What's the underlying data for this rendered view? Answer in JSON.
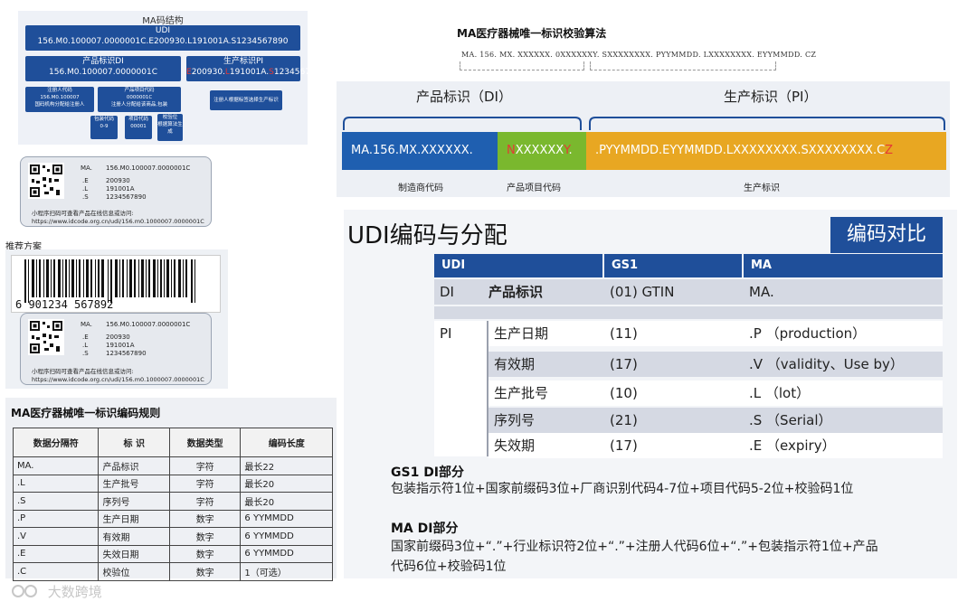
{
  "ma_structure": {
    "title": "MA码结构",
    "udi_label": "UDI",
    "udi_value": "156.M0.100007.0000001C.E200930.L191001A.S1234567890",
    "di_label": "产品标识DI",
    "di_value": "156.M0.100007.0000001C",
    "pi_label": "生产标识PI",
    "pi_value_e": "E",
    "pi_value_rest1": "200930.",
    "pi_value_l": "L",
    "pi_value_rest2": "191001A.",
    "pi_value_s": "S",
    "pi_value_rest3": "1234567890",
    "reg_title": "注册人代码",
    "reg_value": "156.M0.100007",
    "reg_desc": "国码机构分配给注册人",
    "prod_title": "产品项目代码",
    "prod_value": "0000001C",
    "prod_desc": "注册人分配给该商品,包装",
    "pi_desc": "注册人根据标签选择生产标识",
    "pack_title": "包装代码",
    "pack_value": "0-9",
    "item_title": "项目代码",
    "item_value": "00001",
    "check_title": "校验位",
    "check_desc": "根据算法生成"
  },
  "label_card_1": {
    "ma": "MA.",
    "ma_val": "156.M0.100007.0000001C",
    "e": ".E",
    "e_val": "200930",
    "l": ".L",
    "l_val": "191001A",
    "s": ".S",
    "s_val": "1234567890",
    "foot1": "小程序扫码可查看产品在线信息或访问:",
    "foot2": "https://www.idcode.org.cn/udi/156.m0.1000007.0000001C"
  },
  "recommend": {
    "title": "推荐方案",
    "barcode_digits": "6  901234  567892",
    "ma": "MA.",
    "ma_val": "156.M0.100007.0000001C",
    "e": ".E",
    "e_val": "200930",
    "l": ".L",
    "l_val": "191001A",
    "s": ".S",
    "s_val": "1234567890",
    "foot1": "小程序扫码可查看产品在线信息或访问:",
    "foot2": "https://www.idcode.org.cn/udi/156.m0.1000007.0000001C"
  },
  "rules": {
    "title": "MA医疗器械唯一标识编码规则",
    "headers": [
      "数据分隔符",
      "标 识",
      "数据类型",
      "编码长度"
    ],
    "rows": [
      [
        "MA.",
        "产品标识",
        "字符",
        "最长22"
      ],
      [
        ".L",
        "生产批号",
        "字符",
        "最长20"
      ],
      [
        ".S",
        "序列号",
        "字符",
        "最长20"
      ],
      [
        ".P",
        "生产日期",
        "数字",
        "6 YYMMDD"
      ],
      [
        ".V",
        "有效期",
        "数字",
        "6 YYMMDD"
      ],
      [
        ".E",
        "失效日期",
        "数字",
        "6 YYMMDD"
      ],
      [
        ".C",
        "校验位",
        "数字",
        "1（可选）"
      ]
    ]
  },
  "algorithm": {
    "title": "MA医疗器械唯一标识校验算法",
    "line": "MA. 156. MX. XXXXXX. 0XXXXXXY. SXXXXXXXX. PYYMMDD. LXXXXXXXX. EYYMMDD. CZ",
    "di_label": "产品标识（DI）",
    "pi_label": "生产标识（PI）",
    "seg1": "MA.156.MX.XXXXXX.",
    "seg2_n": "N",
    "seg2_mid": "XXXXXX",
    "seg2_y": "Y",
    "seg2_dot": ".",
    "seg3": ".PYYMMDD.EYYMMDD.LXXXXXXXX.SXXXXXXXX.C",
    "seg3_z": "Z",
    "under1": "制造商代码",
    "under2": "产品项目代码",
    "under3": "生产标识"
  },
  "compare": {
    "title": "UDI编码与分配",
    "tag": "编码对比",
    "headers": [
      "UDI",
      "GS1",
      "MA"
    ],
    "di_label": "DI",
    "di_name": "产品标识",
    "di_gs1": "(01) GTIN",
    "di_ma": "MA.",
    "pi_label": "PI",
    "pi_rows": [
      [
        "生产日期",
        "(11)",
        ".P （production）"
      ],
      [
        "有效期",
        "(17)",
        ".V （validity、Use by）"
      ],
      [
        "生产批号",
        "(10)",
        ".L （lot）"
      ],
      [
        "序列号",
        "(21)",
        ".S （Serial）"
      ],
      [
        "失效期",
        "(17)",
        ".E （expiry）"
      ]
    ],
    "gs1_head": "GS1 DI部分",
    "gs1_text": "包装指示符1位+国家前缀码3位+厂商识别代码4-7位+项目代码5-2位+校验码1位",
    "ma_head": "MA DI部分",
    "ma_text1": "国家前缀码3位+“.”+行业标识符2位+“.”+注册人代码6位+“.”+包装指示符1位+产品",
    "ma_text2": "代码6位+校验码1位"
  },
  "watermark": "大数跨境",
  "colors": {
    "brand_blue": "#1f4f9a",
    "green": "#7ab82e",
    "gold": "#e8a722",
    "red": "#e53935"
  }
}
